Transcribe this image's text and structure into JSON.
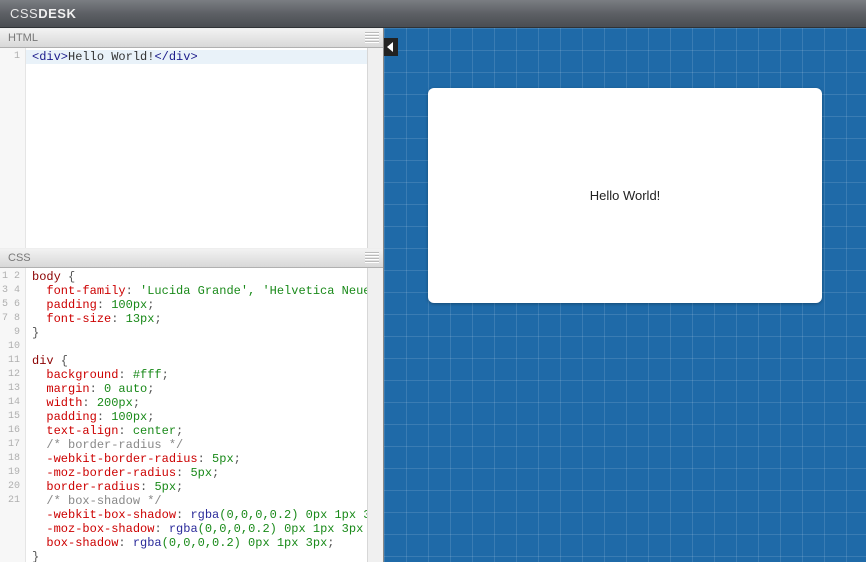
{
  "header": {
    "logo_left": "CSS",
    "logo_right": "DESK"
  },
  "panels": {
    "html": {
      "title": "HTML",
      "lines": [
        {
          "n": "1",
          "tokens": [
            {
              "t": "<div>",
              "c": "tok-tag"
            },
            {
              "t": "Hello World!",
              "c": ""
            },
            {
              "t": "</div>",
              "c": "tok-tag"
            }
          ]
        }
      ]
    },
    "css": {
      "title": "CSS",
      "lines": [
        {
          "n": "1",
          "tokens": [
            {
              "t": "body",
              "c": "tok-sel"
            },
            {
              "t": " {",
              "c": "tok-punc"
            }
          ]
        },
        {
          "n": "2",
          "tokens": [
            {
              "t": "  ",
              "c": ""
            },
            {
              "t": "font-family",
              "c": "tok-prop"
            },
            {
              "t": ": ",
              "c": "tok-punc"
            },
            {
              "t": "'Lucida Grande', 'Helvetica Neue",
              "c": "tok-val"
            }
          ]
        },
        {
          "n": "3",
          "tokens": [
            {
              "t": "  ",
              "c": ""
            },
            {
              "t": "padding",
              "c": "tok-prop"
            },
            {
              "t": ": ",
              "c": "tok-punc"
            },
            {
              "t": "100px",
              "c": "tok-val"
            },
            {
              "t": ";",
              "c": "tok-punc"
            }
          ]
        },
        {
          "n": "4",
          "tokens": [
            {
              "t": "  ",
              "c": ""
            },
            {
              "t": "font-size",
              "c": "tok-prop"
            },
            {
              "t": ": ",
              "c": "tok-punc"
            },
            {
              "t": "13px",
              "c": "tok-val"
            },
            {
              "t": ";",
              "c": "tok-punc"
            }
          ]
        },
        {
          "n": "5",
          "tokens": [
            {
              "t": "}",
              "c": "tok-punc"
            }
          ]
        },
        {
          "n": "6",
          "tokens": [
            {
              "t": " ",
              "c": ""
            }
          ]
        },
        {
          "n": "7",
          "tokens": [
            {
              "t": "div",
              "c": "tok-sel"
            },
            {
              "t": " {",
              "c": "tok-punc"
            }
          ]
        },
        {
          "n": "8",
          "tokens": [
            {
              "t": "  ",
              "c": ""
            },
            {
              "t": "background",
              "c": "tok-prop"
            },
            {
              "t": ": ",
              "c": "tok-punc"
            },
            {
              "t": "#fff",
              "c": "tok-val"
            },
            {
              "t": ";",
              "c": "tok-punc"
            }
          ]
        },
        {
          "n": "9",
          "tokens": [
            {
              "t": "  ",
              "c": ""
            },
            {
              "t": "margin",
              "c": "tok-prop"
            },
            {
              "t": ": ",
              "c": "tok-punc"
            },
            {
              "t": "0 auto",
              "c": "tok-val"
            },
            {
              "t": ";",
              "c": "tok-punc"
            }
          ]
        },
        {
          "n": "10",
          "tokens": [
            {
              "t": "  ",
              "c": ""
            },
            {
              "t": "width",
              "c": "tok-prop"
            },
            {
              "t": ": ",
              "c": "tok-punc"
            },
            {
              "t": "200px",
              "c": "tok-val"
            },
            {
              "t": ";",
              "c": "tok-punc"
            }
          ]
        },
        {
          "n": "11",
          "tokens": [
            {
              "t": "  ",
              "c": ""
            },
            {
              "t": "padding",
              "c": "tok-prop"
            },
            {
              "t": ": ",
              "c": "tok-punc"
            },
            {
              "t": "100px",
              "c": "tok-val"
            },
            {
              "t": ";",
              "c": "tok-punc"
            }
          ]
        },
        {
          "n": "12",
          "tokens": [
            {
              "t": "  ",
              "c": ""
            },
            {
              "t": "text-align",
              "c": "tok-prop"
            },
            {
              "t": ": ",
              "c": "tok-punc"
            },
            {
              "t": "center",
              "c": "tok-val"
            },
            {
              "t": ";",
              "c": "tok-punc"
            }
          ]
        },
        {
          "n": "13",
          "tokens": [
            {
              "t": "  ",
              "c": ""
            },
            {
              "t": "/* border-radius */",
              "c": "tok-comment"
            }
          ]
        },
        {
          "n": "14",
          "tokens": [
            {
              "t": "  ",
              "c": ""
            },
            {
              "t": "-webkit-border-radius",
              "c": "tok-prop"
            },
            {
              "t": ": ",
              "c": "tok-punc"
            },
            {
              "t": "5px",
              "c": "tok-val"
            },
            {
              "t": ";",
              "c": "tok-punc"
            }
          ]
        },
        {
          "n": "15",
          "tokens": [
            {
              "t": "  ",
              "c": ""
            },
            {
              "t": "-moz-border-radius",
              "c": "tok-prop"
            },
            {
              "t": ": ",
              "c": "tok-punc"
            },
            {
              "t": "5px",
              "c": "tok-val"
            },
            {
              "t": ";",
              "c": "tok-punc"
            }
          ]
        },
        {
          "n": "16",
          "tokens": [
            {
              "t": "  ",
              "c": ""
            },
            {
              "t": "border-radius",
              "c": "tok-prop"
            },
            {
              "t": ": ",
              "c": "tok-punc"
            },
            {
              "t": "5px",
              "c": "tok-val"
            },
            {
              "t": ";",
              "c": "tok-punc"
            }
          ]
        },
        {
          "n": "17",
          "tokens": [
            {
              "t": "  ",
              "c": ""
            },
            {
              "t": "/* box-shadow */",
              "c": "tok-comment"
            }
          ]
        },
        {
          "n": "18",
          "tokens": [
            {
              "t": "  ",
              "c": ""
            },
            {
              "t": "-webkit-box-shadow",
              "c": "tok-prop"
            },
            {
              "t": ": ",
              "c": "tok-punc"
            },
            {
              "t": "rgba",
              "c": "tok-func"
            },
            {
              "t": "(0,0,0,0.2) 0px 1px 3",
              "c": "tok-val"
            }
          ]
        },
        {
          "n": "19",
          "tokens": [
            {
              "t": "  ",
              "c": ""
            },
            {
              "t": "-moz-box-shadow",
              "c": "tok-prop"
            },
            {
              "t": ": ",
              "c": "tok-punc"
            },
            {
              "t": "rgba",
              "c": "tok-func"
            },
            {
              "t": "(0,0,0,0.2) 0px 1px 3px",
              "c": "tok-val"
            }
          ]
        },
        {
          "n": "20",
          "tokens": [
            {
              "t": "  ",
              "c": ""
            },
            {
              "t": "box-shadow",
              "c": "tok-prop"
            },
            {
              "t": ": ",
              "c": "tok-punc"
            },
            {
              "t": "rgba",
              "c": "tok-func"
            },
            {
              "t": "(0,0,0,0.2) 0px 1px 3px",
              "c": "tok-val"
            },
            {
              "t": ";",
              "c": "tok-punc"
            }
          ]
        },
        {
          "n": "21",
          "tokens": [
            {
              "t": "}",
              "c": "tok-punc"
            }
          ]
        }
      ]
    }
  },
  "preview": {
    "text": "Hello World!"
  }
}
